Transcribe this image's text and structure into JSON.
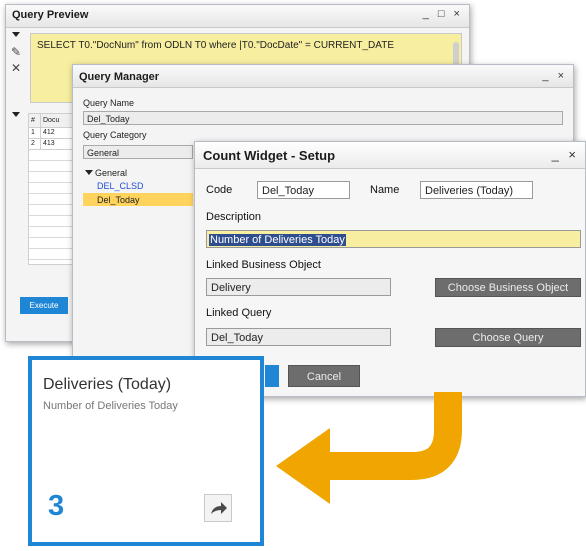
{
  "query_preview": {
    "title": "Query Preview",
    "window_buttons": "_ □ ×",
    "sql_text": "SELECT T0.\"DocNum\" from ODLN T0 where |T0.\"DocDate\" = CURRENT_DATE",
    "grid_headers": [
      "#",
      "Docu"
    ],
    "grid_rows": [
      [
        "1",
        "412"
      ],
      [
        "2",
        "413"
      ]
    ],
    "execute_label": "Execute"
  },
  "query_manager": {
    "title": "Query Manager",
    "window_buttons": "_ ×",
    "query_name_label": "Query Name",
    "query_name_value": "Del_Today",
    "query_category_label": "Query Category",
    "query_category_value": "General",
    "tree_root": "General",
    "tree_items": [
      "DEL_CLSD",
      "Del_Today"
    ]
  },
  "setup": {
    "title": "Count Widget - Setup",
    "window_buttons": "_ ×",
    "code_label": "Code",
    "code_value": "Del_Today",
    "name_label": "Name",
    "name_value": "Deliveries (Today)",
    "description_label": "Description",
    "description_value": "Number of Deliveries Today",
    "linked_bo_label": "Linked Business Object",
    "linked_bo_value": "Delivery",
    "choose_bo_label": "Choose Business Object",
    "linked_query_label": "Linked Query",
    "linked_query_value": "Del_Today",
    "choose_query_label": "Choose Query",
    "cancel_label": "Cancel"
  },
  "widget": {
    "title": "Deliveries (Today)",
    "subtitle": "Number of Deliveries Today",
    "count": "3",
    "icon": "share-arrow-icon"
  },
  "colors": {
    "accent_blue": "#1f86d6",
    "highlight_yellow": "#f7eea0",
    "arrow_orange": "#f0a500",
    "selection_yellow": "#ffd35c"
  }
}
